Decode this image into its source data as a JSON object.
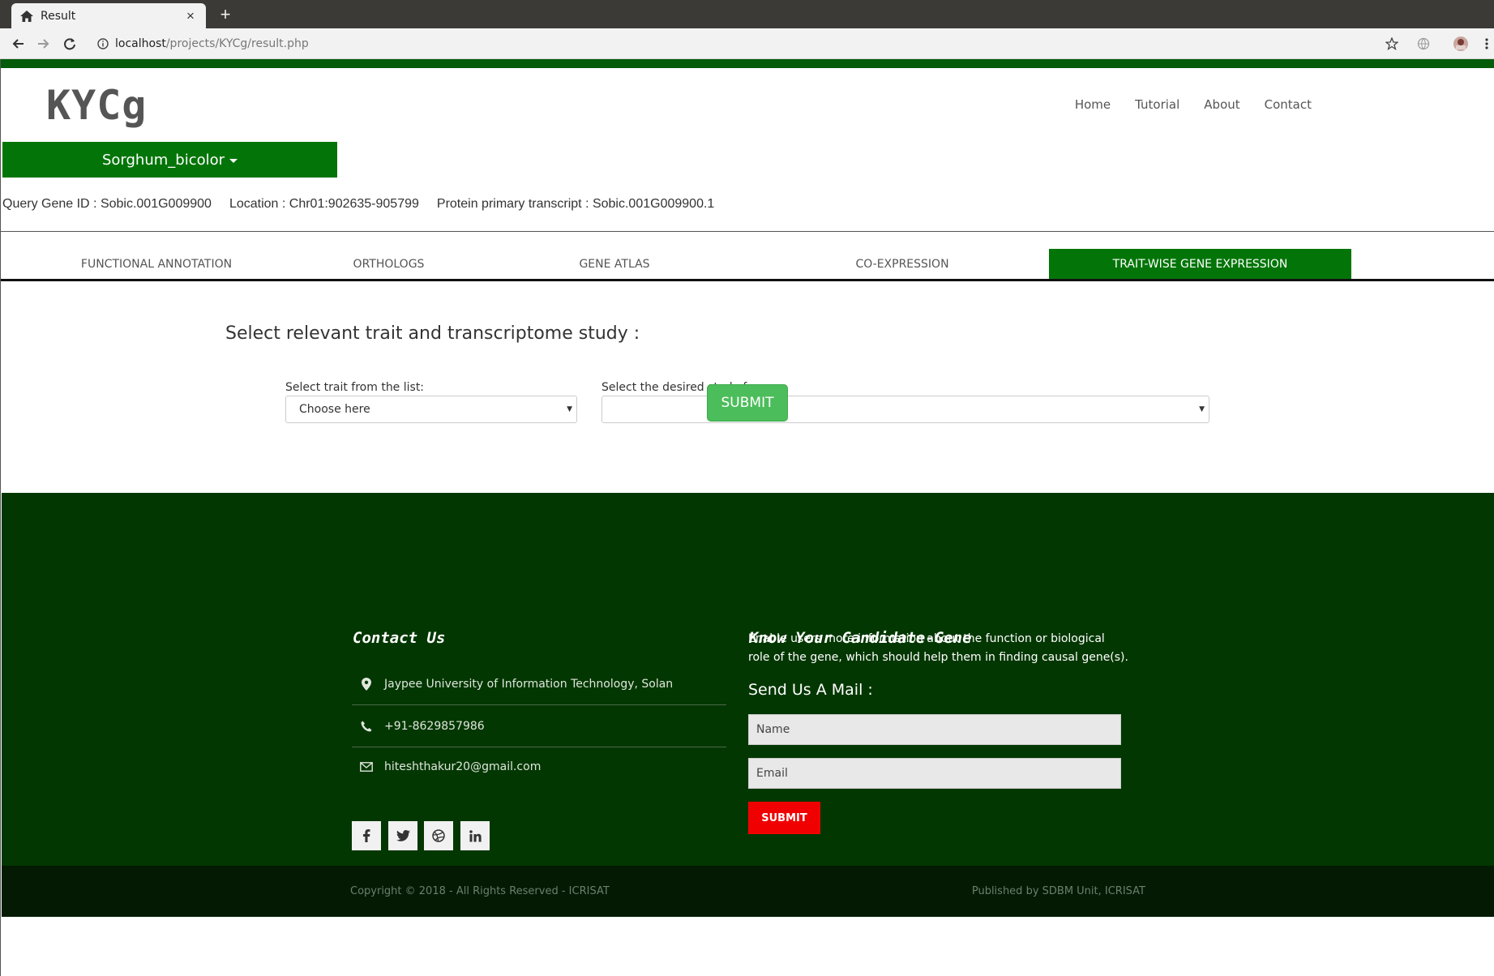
{
  "browser": {
    "tab_title": "Result",
    "tab_close": "×",
    "new_tab": "+",
    "url_host": "localhost",
    "url_path": "/projects/KYCg/result.php"
  },
  "header": {
    "logo": "KYCg",
    "nav": [
      "Home",
      "Tutorial",
      "About",
      "Contact"
    ]
  },
  "species_selector": {
    "label": "Sorghum_bicolor"
  },
  "gene_info": {
    "query": "Query Gene ID : Sobic.001G009900",
    "location": "Location : Chr01:902635-905799",
    "transcript": "Protein primary transcript : Sobic.001G009900.1"
  },
  "tabs": [
    {
      "label": "FUNCTIONAL ANNOTATION",
      "active": false
    },
    {
      "label": "ORTHOLOGS",
      "active": false
    },
    {
      "label": "GENE ATLAS",
      "active": false
    },
    {
      "label": "CO-EXPRESSION",
      "active": false
    },
    {
      "label": "TRAIT-WISE GENE EXPRESSION",
      "active": true
    }
  ],
  "form": {
    "title": "Select relevant trait and transcriptome study :",
    "trait_label": "Select trait from the list:",
    "trait_value": "Choose here",
    "study_label": "Select the desired study for :",
    "study_value": "",
    "submit": "SUBMIT"
  },
  "footer": {
    "contact_heading": "Contact Us",
    "address": "Jaypee University of Information Technology, Solan",
    "phone": "+91-8629857986",
    "email": "hiteshthakur20@gmail.com",
    "social_icons": [
      "facebook-icon",
      "twitter-icon",
      "dribbble-icon",
      "linkedin-icon"
    ],
    "about_heading": "Know Your Candidate-Gene",
    "about_text": "Enable users more information about the function or biological role of the gene, which should help them in finding causal gene(s).",
    "mail_heading": "Send Us A Mail :",
    "name_placeholder": "Name",
    "email_placeholder": "Email",
    "mail_submit": "SUBMIT",
    "copyright": "Copyright © 2018 - All Rights Reserved - ICRISAT",
    "published": "Published by SDBM Unit, ICRISAT"
  },
  "colors": {
    "brand_green": "#037508",
    "footer_bg": "#033701",
    "footer_bottom_bg": "#041a03",
    "submit_green": "#4cbd5b",
    "submit_red": "#f00000"
  }
}
